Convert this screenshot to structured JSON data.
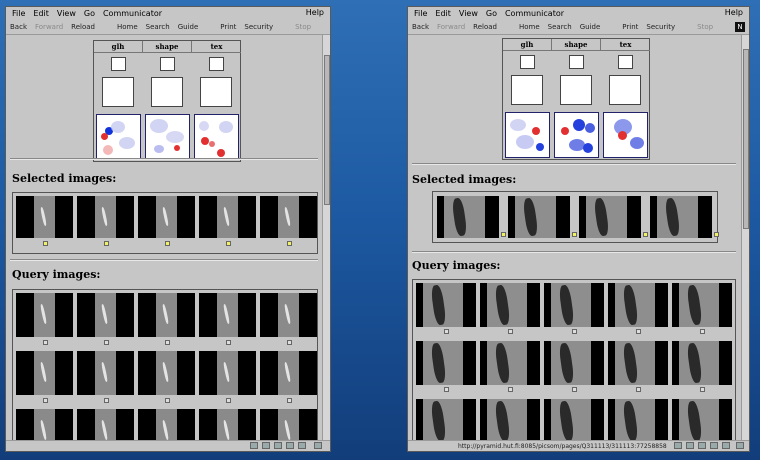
{
  "windows": [
    {
      "menu": [
        "File",
        "Edit",
        "View",
        "Go",
        "Communicator"
      ],
      "help": "Help",
      "toolbar": {
        "back": "Back",
        "forward": "Forward",
        "reload": "Reload",
        "home": "Home",
        "search": "Search",
        "guide": "Guide",
        "print": "Print",
        "security": "Security",
        "stop": "Stop"
      },
      "features": [
        "glh",
        "shape",
        "tex"
      ],
      "selected_heading": "Selected images:",
      "query_heading": "Query images:",
      "status_text": ""
    },
    {
      "menu": [
        "File",
        "Edit",
        "View",
        "Go",
        "Communicator"
      ],
      "help": "Help",
      "toolbar": {
        "back": "Back",
        "forward": "Forward",
        "reload": "Reload",
        "home": "Home",
        "search": "Search",
        "guide": "Guide",
        "print": "Print",
        "security": "Security",
        "stop": "Stop"
      },
      "features": [
        "glh",
        "shape",
        "tex"
      ],
      "selected_heading": "Selected images:",
      "query_heading": "Query images:",
      "status_text": "http://pyramid.hut.fi:8085/picsom/pages/Q311113/311113:77258858"
    }
  ],
  "colors": {
    "window_bg": "#c6c6c6",
    "desktop": "#1d5aa3",
    "selected_checkbox": "#f2f260"
  }
}
